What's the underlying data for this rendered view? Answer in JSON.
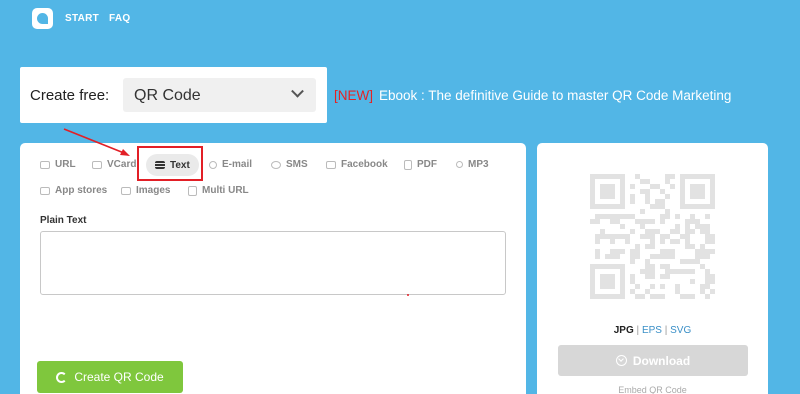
{
  "nav": {
    "start": "START",
    "faq": "FAQ"
  },
  "create": {
    "label": "Create free:",
    "selected": "QR Code"
  },
  "promo": {
    "badge": "[NEW]",
    "text": "Ebook : The definitive Guide to master QR Code Marketing"
  },
  "tabs": [
    {
      "label": "URL",
      "icon": "link-icon"
    },
    {
      "label": "VCard",
      "icon": "vcard-icon"
    },
    {
      "label": "Text",
      "icon": "text-lines-icon",
      "active": true
    },
    {
      "label": "E-mail",
      "icon": "at-icon"
    },
    {
      "label": "SMS",
      "icon": "chat-icon"
    },
    {
      "label": "Facebook",
      "icon": "thumbs-up-icon"
    },
    {
      "label": "PDF",
      "icon": "pdf-icon"
    },
    {
      "label": "MP3",
      "icon": "music-icon"
    },
    {
      "label": "App stores",
      "icon": "app-store-icon"
    },
    {
      "label": "Images",
      "icon": "image-icon"
    },
    {
      "label": "Multi URL",
      "icon": "multi-url-icon"
    }
  ],
  "form": {
    "field_label": "Plain Text",
    "value": ""
  },
  "actions": {
    "create": "Create QR Code"
  },
  "output": {
    "formats": [
      "JPG",
      "EPS",
      "SVG"
    ],
    "separator": "|",
    "download": "Download",
    "embed": "Embed QR Code"
  },
  "colors": {
    "background": "#52b6e6",
    "accent": "#7fc73d",
    "annotation": "#e21f26"
  }
}
